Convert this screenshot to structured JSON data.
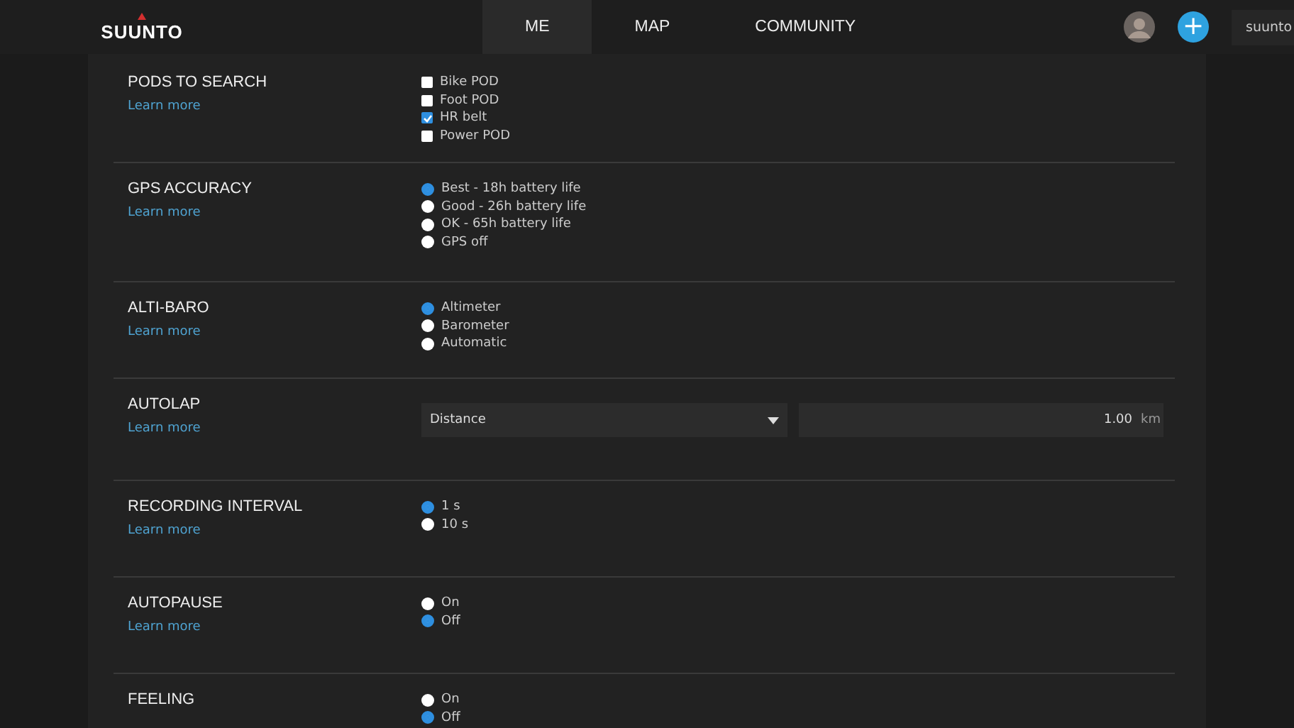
{
  "header": {
    "logo": "SUUNTO",
    "nav": [
      {
        "label": "ME",
        "selected": true
      },
      {
        "label": "MAP",
        "selected": false
      },
      {
        "label": "COMMUNITY",
        "selected": false
      }
    ],
    "add_button": "+",
    "user_button": "suunto"
  },
  "settings": [
    {
      "title": "PODS TO SEARCH",
      "link": "Learn more",
      "kind": "checkbox",
      "options": [
        {
          "label": "Bike POD",
          "checked": false
        },
        {
          "label": "Foot POD",
          "checked": false
        },
        {
          "label": "HR belt",
          "checked": true
        },
        {
          "label": "Power POD",
          "checked": false
        }
      ]
    },
    {
      "title": "GPS ACCURACY",
      "link": "Learn more",
      "kind": "radio",
      "options": [
        {
          "label": "Best - 18h battery life",
          "selected": true
        },
        {
          "label": "Good - 26h battery life",
          "selected": false
        },
        {
          "label": "OK - 65h battery life",
          "selected": false
        },
        {
          "label": "GPS off",
          "selected": false
        }
      ]
    },
    {
      "title": "ALTI-BARO",
      "link": "Learn more",
      "kind": "radio",
      "options": [
        {
          "label": "Altimeter",
          "selected": true
        },
        {
          "label": "Barometer",
          "selected": false
        },
        {
          "label": "Automatic",
          "selected": false
        }
      ]
    },
    {
      "title": "AUTOLAP",
      "link": "Learn more",
      "kind": "autolap",
      "select": "Distance",
      "value": "1.00",
      "unit": "km"
    },
    {
      "title": "RECORDING INTERVAL",
      "link": "Learn more",
      "kind": "radio",
      "options": [
        {
          "label": "1 s",
          "selected": true
        },
        {
          "label": "10 s",
          "selected": false
        }
      ]
    },
    {
      "title": "AUTOPAUSE",
      "link": "Learn more",
      "kind": "radio",
      "options": [
        {
          "label": "On",
          "selected": false
        },
        {
          "label": "Off",
          "selected": true
        }
      ]
    },
    {
      "title": "FEELING",
      "kind": "radio",
      "options": [
        {
          "label": "On",
          "selected": false
        },
        {
          "label": "Off",
          "selected": true
        }
      ]
    }
  ]
}
